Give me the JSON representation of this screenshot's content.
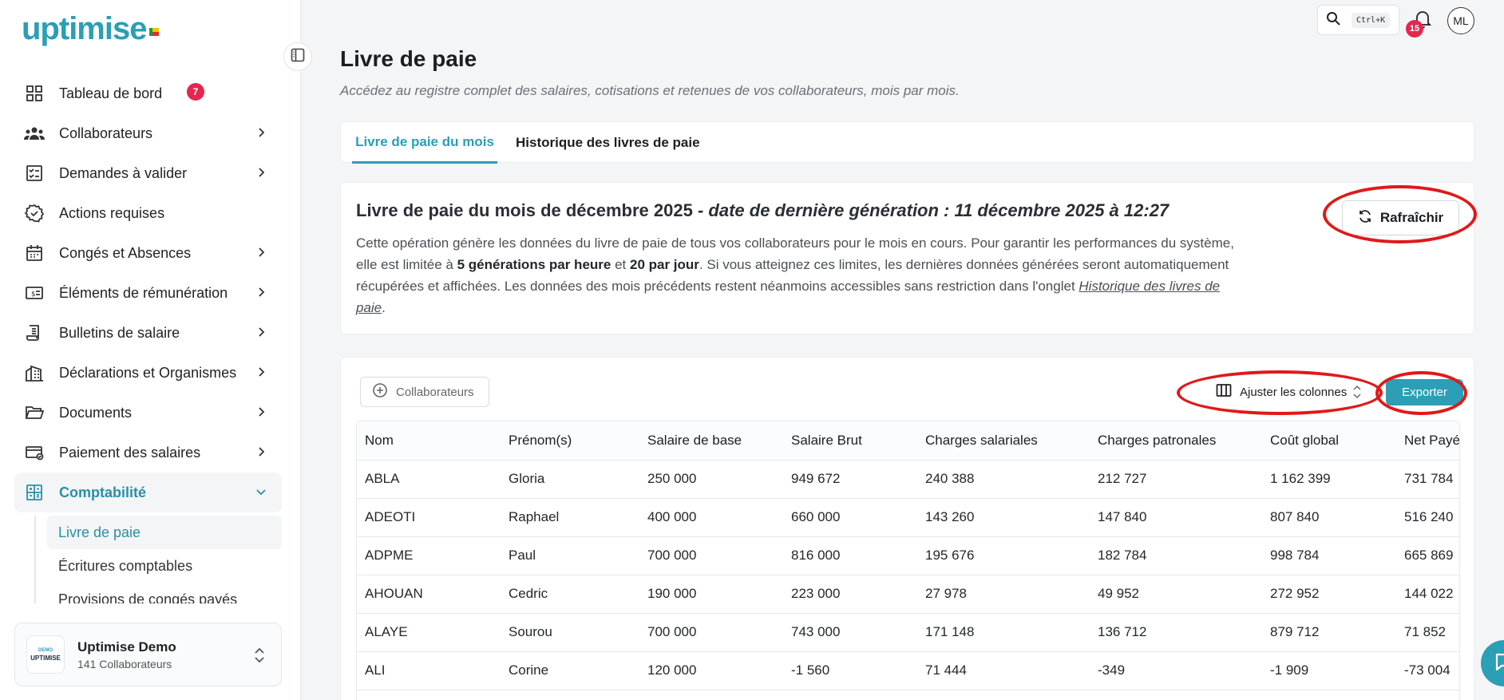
{
  "app": {
    "logo_text": "uptimise"
  },
  "topbar": {
    "search_shortcut": "Ctrl+K",
    "notifications_count": "15",
    "avatar_initials": "ML"
  },
  "sidebar": {
    "items": [
      {
        "label": "Tableau de bord",
        "icon": "grid-icon"
      },
      {
        "label": "Collaborateurs",
        "icon": "users-icon"
      },
      {
        "label": "Demandes à valider",
        "icon": "checklist-icon",
        "badge": "7"
      },
      {
        "label": "Actions requises",
        "icon": "badge-check-icon"
      },
      {
        "label": "Congés et Absences",
        "icon": "calendar-icon"
      },
      {
        "label": "Éléments de rémunération",
        "icon": "money-icon"
      },
      {
        "label": "Bulletins de salaire",
        "icon": "receipt-icon"
      },
      {
        "label": "Déclarations et Organismes",
        "icon": "building-icon"
      },
      {
        "label": "Documents",
        "icon": "folder-icon"
      },
      {
        "label": "Paiement des salaires",
        "icon": "card-icon"
      },
      {
        "label": "Comptabilité",
        "icon": "calculator-icon"
      }
    ],
    "subitems": [
      {
        "label": "Livre de paie"
      },
      {
        "label": "Écritures comptables"
      },
      {
        "label": "Provisions de congés payés"
      }
    ],
    "org": {
      "name": "Uptimise Demo",
      "subtitle": "141 Collaborateurs",
      "logo_line1": "DEMO",
      "logo_line2": "UPTIMISE"
    }
  },
  "main": {
    "title": "Livre de paie",
    "subtitle": "Accédez au registre complet des salaires, cotisations et retenues de vos collaborateurs, mois par mois.",
    "tabs": [
      {
        "label": "Livre de paie du mois"
      },
      {
        "label": "Historique des livres de paie"
      }
    ],
    "info": {
      "title_main": "Livre de paie du mois de décembre 2025",
      "title_date": " - date de dernière génération : 11 décembre 2025 à 12:27",
      "body_p1": "Cette opération génère les données du livre de paie de tous vos collaborateurs pour le mois en cours. Pour garantir les performances du système, elle est limitée à ",
      "body_b1": "5 générations par heure",
      "body_p2": " et ",
      "body_b2": "20 par jour",
      "body_p3": ". Si vous atteignez ces limites, les dernières données générées seront automatiquement récupérées et affichées. Les données des mois précédents restent néanmoins accessibles sans restriction dans l'onglet ",
      "body_link": "Historique des livres de paie",
      "body_end": ".",
      "refresh_label": "Rafraîchir"
    },
    "toolbar": {
      "filter_label": "Collaborateurs",
      "columns_label": "Ajuster les colonnes",
      "export_label": "Exporter"
    },
    "table": {
      "columns": [
        "Nom",
        "Prénom(s)",
        "Salaire de base",
        "Salaire Brut",
        "Charges salariales",
        "Charges patronales",
        "Coût global",
        "Net Payé"
      ],
      "rows": [
        [
          "ABLA",
          "Gloria",
          "250 000",
          "949 672",
          "240 388",
          "212 727",
          "1 162 399",
          "731 784"
        ],
        [
          "ADEOTI",
          "Raphael",
          "400 000",
          "660 000",
          "143 260",
          "147 840",
          "807 840",
          "516 240"
        ],
        [
          "ADPME",
          "Paul",
          "700 000",
          "816 000",
          "195 676",
          "182 784",
          "998 784",
          "665 869"
        ],
        [
          "AHOUAN",
          "Cedric",
          "190 000",
          "223 000",
          "27 978",
          "49 952",
          "272 952",
          "144 022"
        ],
        [
          "ALAYE",
          "Sourou",
          "700 000",
          "743 000",
          "171 148",
          "136 712",
          "879 712",
          "71 852"
        ],
        [
          "ALI",
          "Corine",
          "120 000",
          "-1 560",
          "71 444",
          "-349",
          "-1 909",
          "-73 004"
        ]
      ]
    }
  },
  "colors": {
    "accent": "#2a9fb5",
    "badge": "#e5264f",
    "annotation": "#e01919"
  }
}
